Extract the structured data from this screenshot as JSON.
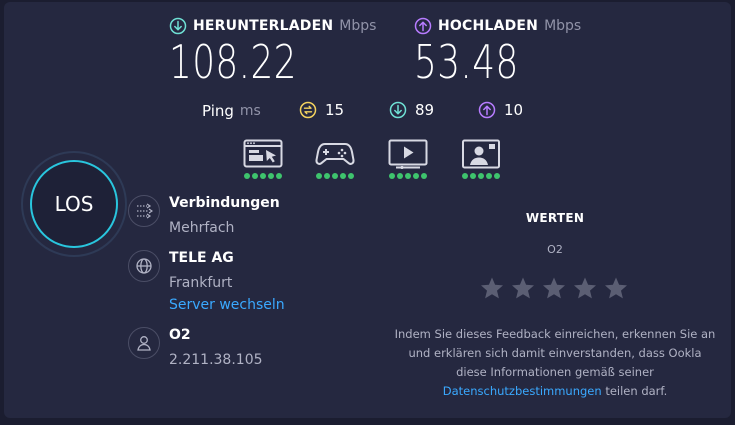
{
  "download": {
    "title": "HERUNTERLADEN",
    "unit": "Mbps",
    "value": "108.22",
    "color": "#6fe0d4"
  },
  "upload": {
    "title": "HOCHLADEN",
    "unit": "Mbps",
    "value": "53.48",
    "color": "#b77cff"
  },
  "ping": {
    "label": "Ping",
    "unit": "ms",
    "idle": "15",
    "download": "89",
    "upload": "10",
    "idle_color": "#f4d35e",
    "download_color": "#6fe0d4",
    "upload_color": "#b77cff"
  },
  "apps": [
    {
      "name": "web-browsing-icon",
      "rating": 5
    },
    {
      "name": "gaming-icon",
      "rating": 5
    },
    {
      "name": "video-streaming-icon",
      "rating": 5
    },
    {
      "name": "video-chat-icon",
      "rating": 5
    }
  ],
  "go_label": "LOS",
  "connections": {
    "title": "Verbindungen",
    "value": "Mehrfach"
  },
  "server": {
    "name": "TELE AG",
    "location": "Frankfurt",
    "change_link": "Server wechseln"
  },
  "provider": {
    "name": "O2",
    "ip": "2.211.38.105"
  },
  "rating": {
    "title": "WERTEN",
    "subject": "O2",
    "stars": 5
  },
  "disclaimer": {
    "before": "Indem Sie dieses Feedback einreichen, erkennen Sie an und erklären sich damit einverstanden, dass Ookla diese Informationen gemäß seiner",
    "link": "Datenschutzbestimmungen",
    "after": "teilen darf."
  }
}
